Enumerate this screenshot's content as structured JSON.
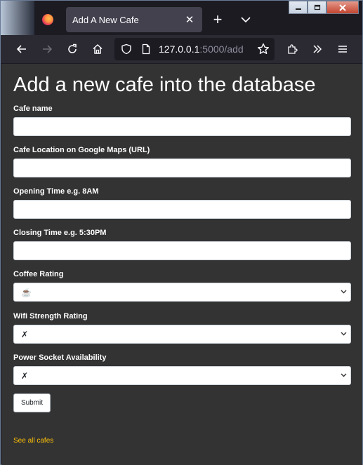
{
  "tab": {
    "title": "Add A New Cafe",
    "close": "✕",
    "new_tab": "+"
  },
  "window_controls": {
    "minimize": "",
    "maximize": "",
    "close": ""
  },
  "nav": {
    "url_host": "127.0.0.1",
    "url_path": ":5000/add"
  },
  "page": {
    "title": "Add a new cafe into the database",
    "fields": {
      "cafe_name": {
        "label": "Cafe name",
        "value": ""
      },
      "location": {
        "label": "Cafe Location on Google Maps (URL)",
        "value": ""
      },
      "open_time": {
        "label": "Opening Time e.g. 8AM",
        "value": ""
      },
      "close_time": {
        "label": "Closing Time e.g. 5:30PM",
        "value": ""
      },
      "coffee_rating": {
        "label": "Coffee Rating",
        "selected": "☕"
      },
      "wifi_rating": {
        "label": "Wifi Strength Rating",
        "selected": "✗"
      },
      "power_rating": {
        "label": "Power Socket Availability",
        "selected": "✗"
      }
    },
    "submit_label": "Submit",
    "see_all_link": "See all cafes"
  },
  "colors": {
    "background": "#333333",
    "link": "#ffc107",
    "tab_active": "#42414d",
    "toolbar": "#2b2a33"
  }
}
